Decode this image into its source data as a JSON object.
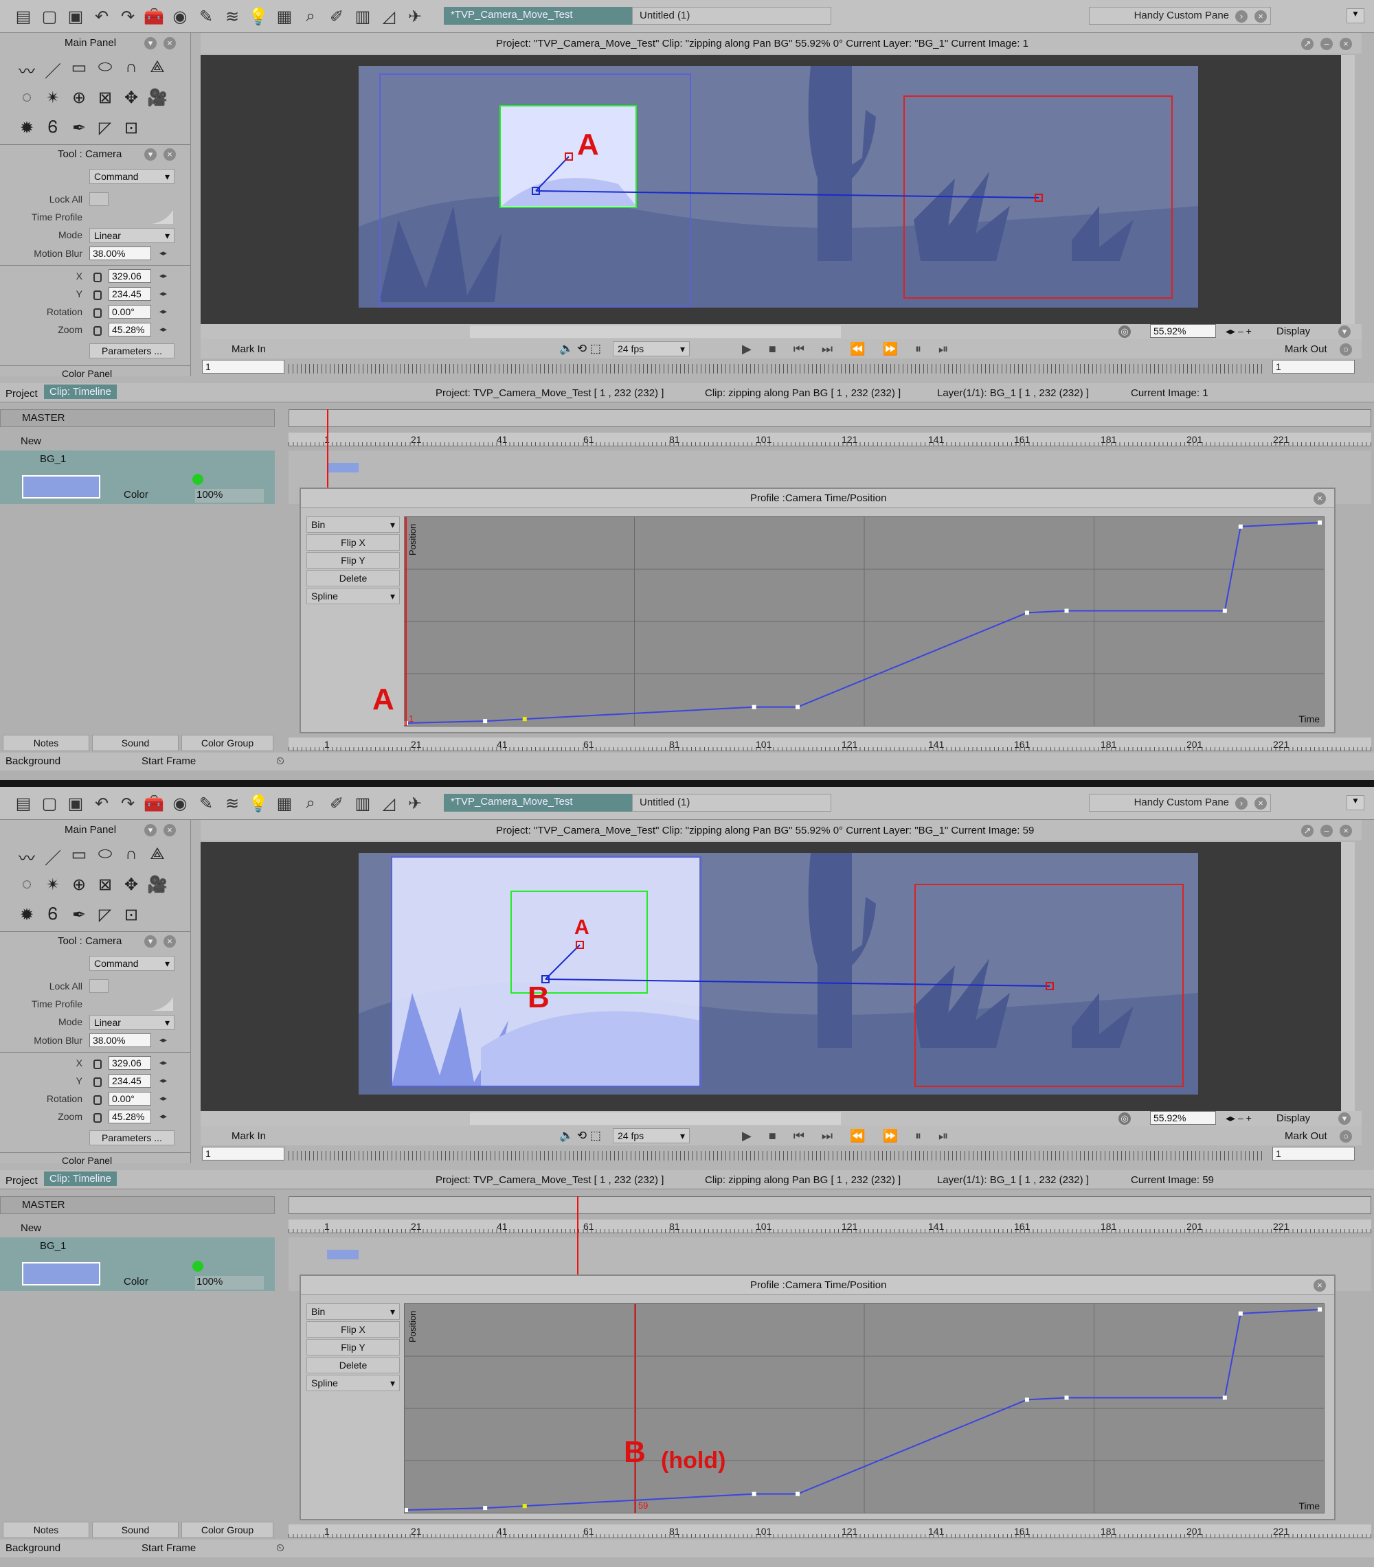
{
  "toolbar": {
    "icons": [
      "new-icon",
      "open-icon",
      "save-icon",
      "undo-icon",
      "redo-icon",
      "toolbox-icon",
      "color-wheel-icon",
      "sketch-icon",
      "layers-icon",
      "bulb-icon",
      "keypad-icon",
      "search-icon",
      "brush-icon",
      "library-icon",
      "chart-icon",
      "plane-icon"
    ],
    "doc_tab_active": "*TVP_Camera_Move_Test",
    "doc_tab_inactive": "Untitled (1)",
    "custom_pane": "Handy Custom Pane"
  },
  "left_panel": {
    "main_panel": "Main Panel",
    "tool_title": "Tool : Camera",
    "command": "Command",
    "lock_all": "Lock All",
    "time_profile": "Time Profile",
    "mode_label": "Mode",
    "mode_value": "Linear",
    "motion_blur_label": "Motion Blur",
    "motion_blur_value": "38.00%",
    "x_label": "X",
    "x_value": "329.06",
    "y_label": "Y",
    "y_value": "234.45",
    "rotation_label": "Rotation",
    "rotation_value": "0.00°",
    "zoom_label": "Zoom",
    "zoom_value": "45.28%",
    "parameters": "Parameters ...",
    "color_panel": "Color Panel"
  },
  "viewer": {
    "zoom_value": "55.92%",
    "display": "Display",
    "mark_in": "Mark In",
    "mark_out": "Mark Out",
    "fps": "24 fps",
    "mark_in_value": "1",
    "mark_out_value": "1"
  },
  "timeline": {
    "project_tab": "Project",
    "clip_tab": "Clip: Timeline",
    "project_info": "Project: TVP_Camera_Move_Test [ 1 , 232  (232) ]",
    "clip_info": "Clip: zipping along Pan BG [ 1 , 232  (232) ]",
    "layer_info": "Layer(1/1): BG_1 [ 1 , 232  (232) ]",
    "master": "MASTER",
    "new": "New",
    "layer_name": "BG_1",
    "color_label": "Color",
    "opacity": "100%",
    "ruler_ticks": [
      "1",
      "21",
      "41",
      "61",
      "81",
      "101",
      "121",
      "141",
      "161",
      "181",
      "201",
      "221"
    ],
    "notes": "Notes",
    "sound": "Sound",
    "color_group": "Color Group",
    "background": "Background",
    "start_frame": "Start Frame"
  },
  "profile": {
    "title": "Profile :Camera Time/Position",
    "bin": "Bin",
    "flip_x": "Flip X",
    "flip_y": "Flip Y",
    "delete": "Delete",
    "spline": "Spline",
    "y_axis": "Position",
    "x_axis": "Time"
  },
  "chart_data": {
    "type": "line",
    "title": "Profile :Camera Time/Position",
    "xlabel": "Time",
    "ylabel": "Position",
    "x": [
      1,
      21,
      31,
      89,
      100,
      158,
      168,
      208,
      212,
      232
    ],
    "y": [
      0.0,
      0.01,
      0.02,
      0.08,
      0.08,
      0.55,
      0.56,
      0.56,
      0.98,
      1.0
    ],
    "xlim": [
      1,
      232
    ]
  },
  "shots": [
    {
      "header": "Project:  \"TVP_Camera_Move_Test\"  Clip: \"zipping along Pan BG\"  55.92%  0°  Current Layer: \"BG_1\"  Current Image: 1",
      "current_image": "Current Image: 1",
      "playhead_label": "1",
      "annotation_scene": "A",
      "annotation_graph": "A",
      "annotation_extra": ""
    },
    {
      "header": "Project:  \"TVP_Camera_Move_Test\"  Clip: \"zipping along Pan BG\"  55.92%  0°  Current Layer: \"BG_1\"  Current Image: 59",
      "current_image": "Current Image: 59",
      "playhead_label": "59",
      "annotation_scene": "A",
      "annotation_scene_b": "B",
      "annotation_graph": "B",
      "annotation_extra": "(hold)"
    }
  ]
}
